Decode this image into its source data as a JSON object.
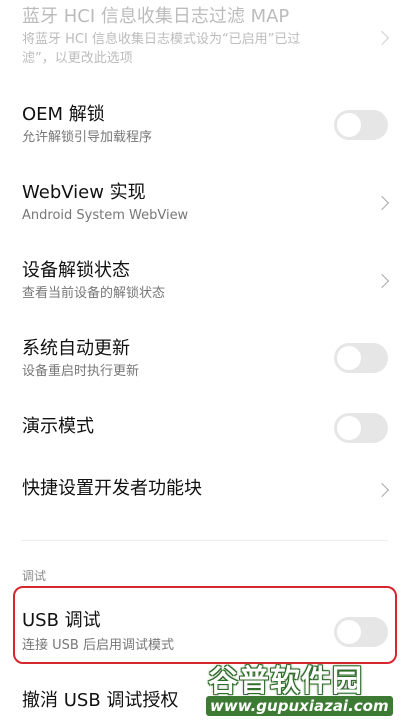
{
  "settings": {
    "bt_hci": {
      "title": "蓝牙 HCI 信息收集日志过滤 MAP",
      "subtitle_line1": "将蓝牙 HCI 信息收集日志模式设为“已启用”已过",
      "subtitle_line2": "滤”，以更改此选项"
    },
    "oem_unlock": {
      "title": "OEM 解锁",
      "subtitle": "允许解锁引导加载程序",
      "enabled": false
    },
    "webview": {
      "title": "WebView 实现",
      "subtitle": "Android System WebView"
    },
    "unlock_status": {
      "title": "设备解锁状态",
      "subtitle": "查看当前设备的解锁状态"
    },
    "auto_update": {
      "title": "系统自动更新",
      "subtitle": "设备重启时执行更新",
      "enabled": false
    },
    "demo_mode": {
      "title": "演示模式",
      "enabled": false
    },
    "quick_tiles": {
      "title": "快捷设置开发者功能块"
    }
  },
  "debug_section": {
    "header": "调试",
    "usb_debugging": {
      "title": "USB 调试",
      "subtitle": "连接 USB 后启用调试模式",
      "enabled": false
    },
    "revoke_usb": {
      "title": "撤消 USB 调试授权"
    }
  },
  "watermark": {
    "brand": "谷普软件园",
    "url": "www.gupuxiazai.com"
  },
  "colors": {
    "highlight": "#d8262e",
    "toggle_off": "#e6e6e6"
  }
}
